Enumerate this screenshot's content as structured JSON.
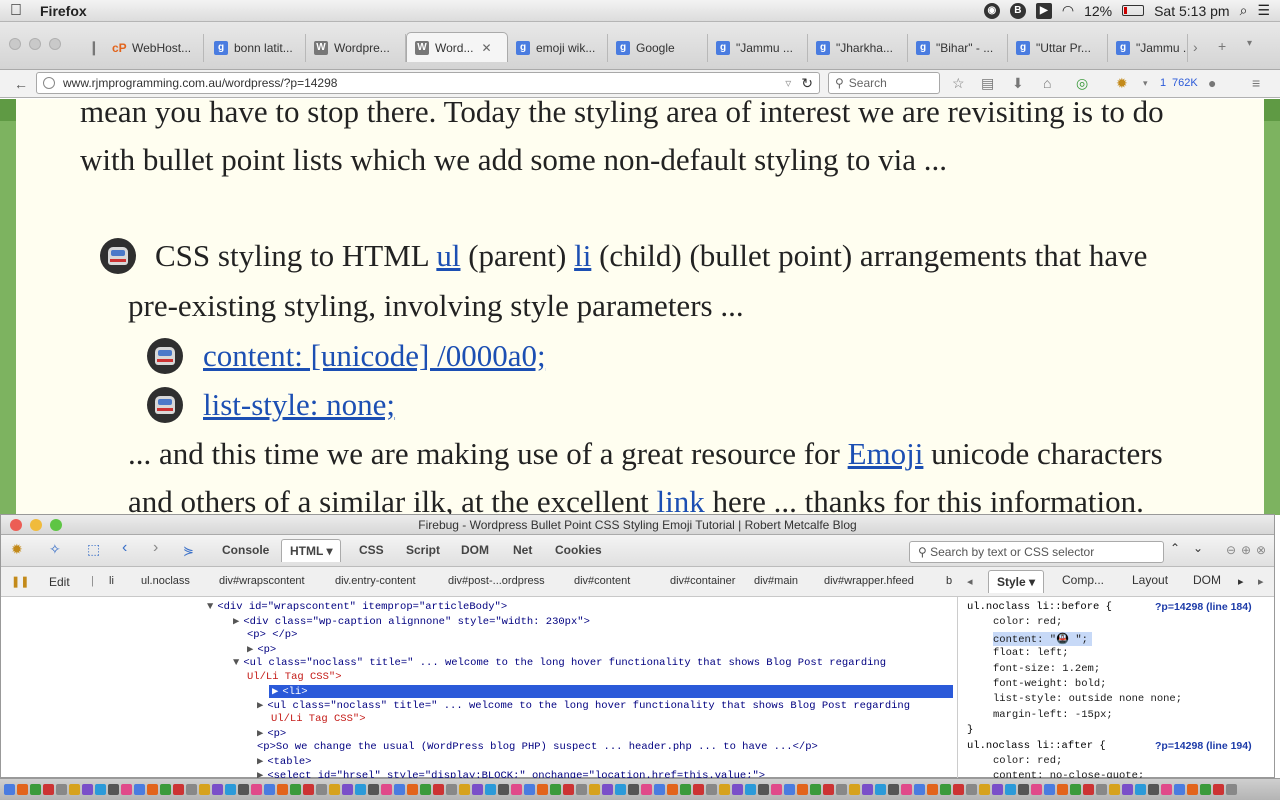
{
  "menubar": {
    "app_name": "Firefox",
    "status_icons": [
      "camera-icon",
      "b-icon",
      "delta-icon",
      "wifi-icon"
    ],
    "battery": "12%",
    "clock": "Sat 5:13 pm"
  },
  "tabs": [
    {
      "label": "WebHost...",
      "icon": "cp",
      "active": false
    },
    {
      "label": "bonn latit...",
      "icon": "g",
      "active": false
    },
    {
      "label": "Wordpre...",
      "icon": "w",
      "active": false
    },
    {
      "label": "Word...",
      "icon": "w",
      "active": true
    },
    {
      "label": "emoji wik...",
      "icon": "g",
      "active": false
    },
    {
      "label": "Google",
      "icon": "g",
      "active": false
    },
    {
      "label": "\"Jammu ...",
      "icon": "g",
      "active": false
    },
    {
      "label": "\"Jharkha...",
      "icon": "g",
      "active": false
    },
    {
      "label": "\"Bihar\" - ...",
      "icon": "g",
      "active": false
    },
    {
      "label": "\"Uttar Pr...",
      "icon": "g",
      "active": false
    },
    {
      "label": "\"Jammu ...",
      "icon": "g",
      "active": false
    }
  ],
  "navbar": {
    "url": "www.rjmprogramming.com.au/wordpress/?p=14298",
    "search_placeholder": "Search",
    "download_count": "1",
    "memory": "762K"
  },
  "article": {
    "line1": "mean you have to stop there. Today the styling area of interest we are revisiting is to do",
    "line2": "with bullet point lists which we add some non-default styling to via ...",
    "li1_a": "CSS styling to HTML ",
    "li1_link1": "ul",
    "li1_b": " (parent) ",
    "li1_link2": "li",
    "li1_c": " (child) (bullet point) arrangements that have",
    "li1_line2": "pre-existing styling, involving style parameters ...",
    "sub1": "content: [unicode] /0000a0;",
    "sub2": "list-style: none;",
    "line5_a": "... and this time we are making use of a great resource for ",
    "line5_link": "Emoji",
    "line5_b": " unicode characters",
    "line6_a": "and others of a similar ilk, at the excellent ",
    "line6_link": "link",
    "line6_b": " here ... thanks for this information."
  },
  "firebug": {
    "title": "Firebug - Wordpress Bullet Point CSS Styling Emoji Tutorial | Robert Metcalfe Blog",
    "panels": [
      "Console",
      "HTML",
      "CSS",
      "Script",
      "DOM",
      "Net",
      "Cookies"
    ],
    "active_panel": "HTML",
    "search_placeholder": "Search by text or CSS selector",
    "edit_label": "Edit",
    "breadcrumbs": [
      "li",
      "ul.noclass",
      "div#wrapscontent",
      "div.entry-content",
      "div#post-...ordpress",
      "div#content",
      "div#container",
      "div#main",
      "div#wrapper.hfeed",
      "b"
    ],
    "side_tabs": [
      "Style",
      "Comp...",
      "Layout",
      "DOM"
    ],
    "html_lines": [
      {
        "text": "<div id=\"wrapscontent\" itemprop=\"articleBody\">",
        "twisty": "▼"
      },
      {
        "text": "<div class=\"wp-caption alignnone\" style=\"width: 230px\">",
        "twisty": "▶"
      },
      {
        "text": "<p> </p>",
        "twisty": ""
      },
      {
        "text": "<p>",
        "twisty": "▶"
      },
      {
        "text": "<ul class=\"noclass\" title=\" ... welcome to the long hover functionality that shows Blog Post regarding",
        "twisty": "▼"
      },
      {
        "text": "Ul/Li Tag CSS\">",
        "twisty": ""
      },
      {
        "text": "<li>",
        "twisty": "▶"
      },
      {
        "text": "<ul class=\"noclass\" title=\" ... welcome to the long hover functionality that shows Blog Post regarding",
        "twisty": "▶"
      },
      {
        "text": "Ul/Li Tag CSS\">",
        "twisty": ""
      },
      {
        "text": "<p>",
        "twisty": "▶"
      },
      {
        "text": "<p>So we change the usual (WordPress blog PHP) suspect ... header.php ... to have ...</p>",
        "twisty": ""
      },
      {
        "text": "<table>",
        "twisty": "▶"
      },
      {
        "text": "<select id=\"hrsel\" style=\"display:BLOCK;\" onchange=\"location.href=this.value;\">",
        "twisty": "▶"
      }
    ],
    "style_lines": [
      {
        "text": "ul.noclass li::before {",
        "src": "?p=14298 (line 184)"
      },
      {
        "text": "color: red;",
        "src": ""
      },
      {
        "text": "content: \"🚇  \";",
        "src": ""
      },
      {
        "text": "float: left;",
        "src": ""
      },
      {
        "text": "font-size: 1.2em;",
        "src": ""
      },
      {
        "text": "font-weight: bold;",
        "src": ""
      },
      {
        "text": "list-style: outside none none;",
        "src": ""
      },
      {
        "text": "margin-left: -15px;",
        "src": ""
      },
      {
        "text": "}",
        "src": ""
      },
      {
        "text": "ul.noclass li::after {",
        "src": "?p=14298 (line 194)"
      },
      {
        "text": "color: red;",
        "src": ""
      },
      {
        "text": "content: no-close-quote;",
        "src": ""
      }
    ]
  }
}
